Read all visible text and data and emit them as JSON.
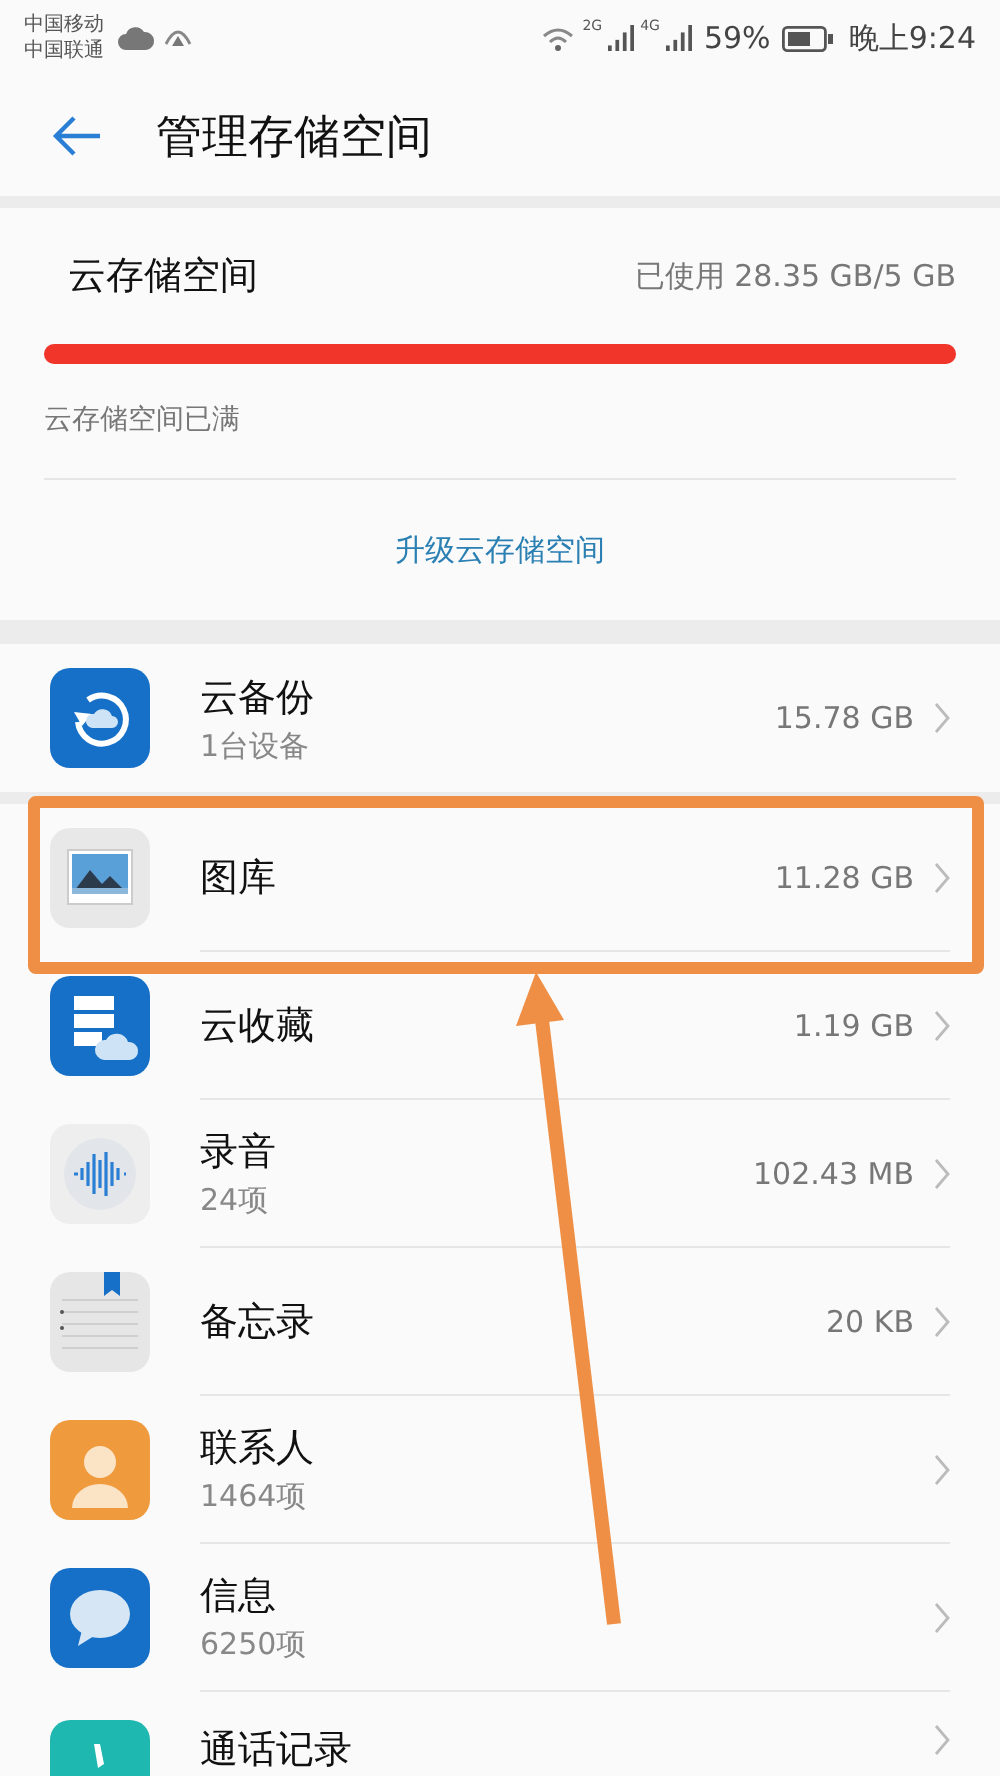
{
  "status_bar": {
    "carriers": [
      "中国移动",
      "中国联通"
    ],
    "network_labels": [
      "2G",
      "4G"
    ],
    "battery": "59%",
    "time": "晚上9:24"
  },
  "header": {
    "title": "管理存储空间"
  },
  "storage": {
    "title": "云存储空间",
    "usage": "已使用 28.35 GB/5 GB",
    "level": 1,
    "note": "云存储空间已满",
    "upgrade_link": "升级云存储空间"
  },
  "items": [
    {
      "name": "云备份",
      "subtitle": "1台设备",
      "size": "15.78 GB"
    },
    {
      "name": "图库",
      "size": "11.28 GB"
    },
    {
      "name": "云收藏",
      "size": "1.19 GB"
    },
    {
      "name": "录音",
      "subtitle": "24项",
      "size": "102.43 MB"
    },
    {
      "name": "备忘录",
      "size": "20 KB"
    },
    {
      "name": "联系人",
      "subtitle": "1464项"
    },
    {
      "name": "信息",
      "subtitle": "6250项"
    },
    {
      "name": "通话记录"
    }
  ]
}
